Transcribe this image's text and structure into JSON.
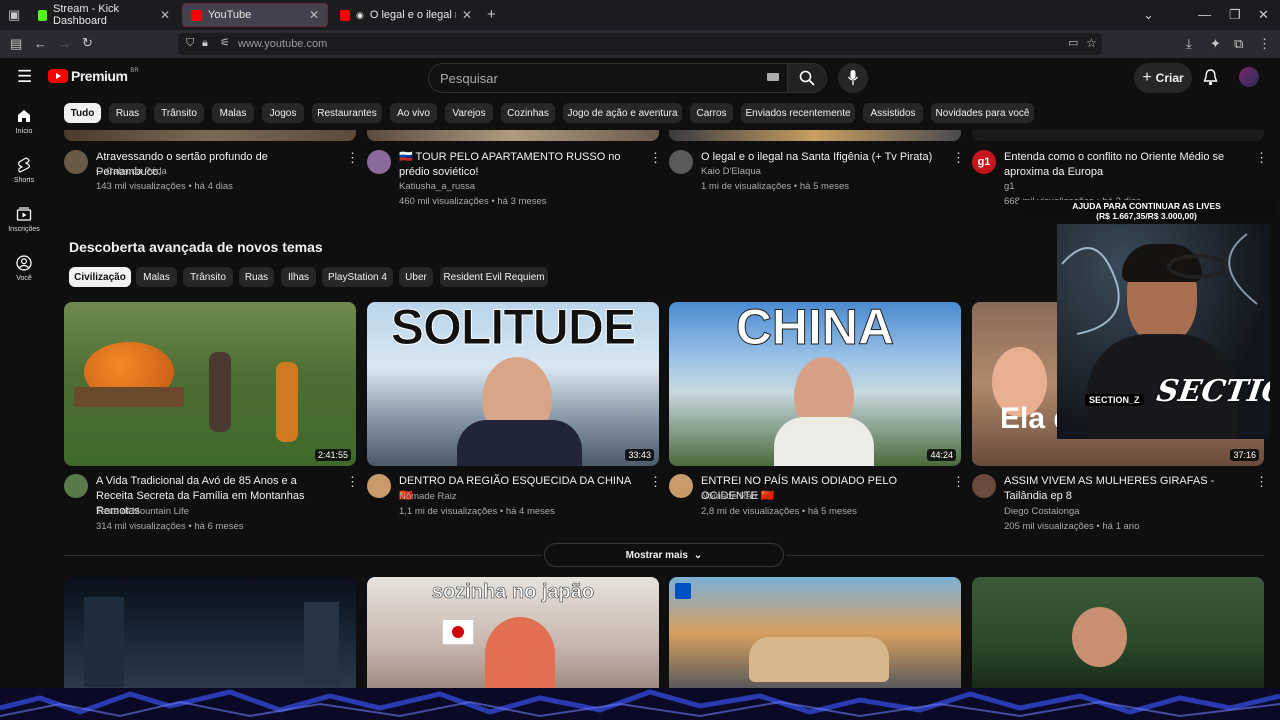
{
  "browser": {
    "tabs": [
      {
        "title": "Stream - Kick Dashboard"
      },
      {
        "title": "YouTube"
      },
      {
        "title": "O legal e o ilegal na Santa I"
      }
    ],
    "url": "www.youtube.com"
  },
  "header": {
    "logo_text": "Premium",
    "logo_region": "BR",
    "search_placeholder": "Pesquisar",
    "create_label": "Criar"
  },
  "sidebar": {
    "items": [
      {
        "label": "Início"
      },
      {
        "label": "Shorts"
      },
      {
        "label": "Inscrições"
      },
      {
        "label": "Você"
      }
    ]
  },
  "chips": [
    "Tudo",
    "Ruas",
    "Trânsito",
    "Malas",
    "Jogos",
    "Restaurantes",
    "Ao vivo",
    "Varejos",
    "Cozinhas",
    "Jogo de ação e aventura",
    "Carros",
    "Enviados recentemente",
    "Assistidos",
    "Novidades para você"
  ],
  "top_videos": [
    {
      "title": "Atravessando o sertão profundo de Pernambuco.",
      "channel": "O Caba da Péda",
      "meta": "143 mil visualizações • há 4 dias"
    },
    {
      "title": "🇷🇺 TOUR PELO APARTAMENTO RUSSO no prédio soviético!",
      "channel": "Katiusha_a_russa",
      "meta": "460 mil visualizações • há 3 meses"
    },
    {
      "title": "O legal e o ilegal na Santa Ifigênia (+ Tv Pirata)",
      "channel": "Kaio D'Elaqua",
      "meta": "1 mi de visualizações • há 5 meses"
    },
    {
      "title": "Entenda como o conflito no Oriente Médio se aproxima da Europa",
      "channel": "g1",
      "meta": "668 mil visualizações • há 2 dias"
    }
  ],
  "section": {
    "title": "Descoberta avançada de novos temas",
    "chips": [
      "Civilização",
      "Malas",
      "Trânsito",
      "Ruas",
      "Ilhas",
      "PlayStation 4",
      "Uber",
      "Resident Evil Requiem"
    ],
    "videos": [
      {
        "title": "A Vida Tradicional da Avó de 85 Anos e a Receita Secreta da Família em Montanhas Remotas",
        "channel": "Taste of Mountain Life",
        "meta": "314 mil visualizações • há 6 meses",
        "duration": "2:41:55",
        "thumb_text": ""
      },
      {
        "title": "DENTRO DA REGIÃO ESQUECIDA DA CHINA 🇨🇳",
        "channel": "Nômade Raiz",
        "meta": "1,1 mi de visualizações • há 4 meses",
        "duration": "33:43",
        "thumb_text": "SOLITUDE"
      },
      {
        "title": "ENTREI NO PAÍS MAIS ODIADO PELO OCIDENTE 🇨🇳",
        "channel": "Nômade Raiz",
        "meta": "2,8 mi de visualizações • há 5 meses",
        "duration": "44:24",
        "thumb_text": "CHINA"
      },
      {
        "title": "ASSIM VIVEM AS MULHERES GIRAFAS - Tailândia ep 8",
        "channel": "Diego Costalonga",
        "meta": "205 mil visualizações • há 1 ano",
        "duration": "37:16",
        "thumb_text": "Ela disse tudo"
      }
    ],
    "show_more": "Mostrar mais"
  },
  "bottom_thumbs": [
    "",
    "sozinha no japão",
    "",
    ""
  ],
  "overlay": {
    "goal_line1": "AJUDA PARA CONTINUAR AS LIVES",
    "goal_line2": "(R$ 1.667,35/R$ 3.000,00)",
    "streamer_tag": "SECTION_Z",
    "logo_text": "SECTION"
  },
  "colors": {
    "accent": "#ff0000",
    "kick_green": "#53fc18",
    "bg": "#0f0f0f"
  }
}
